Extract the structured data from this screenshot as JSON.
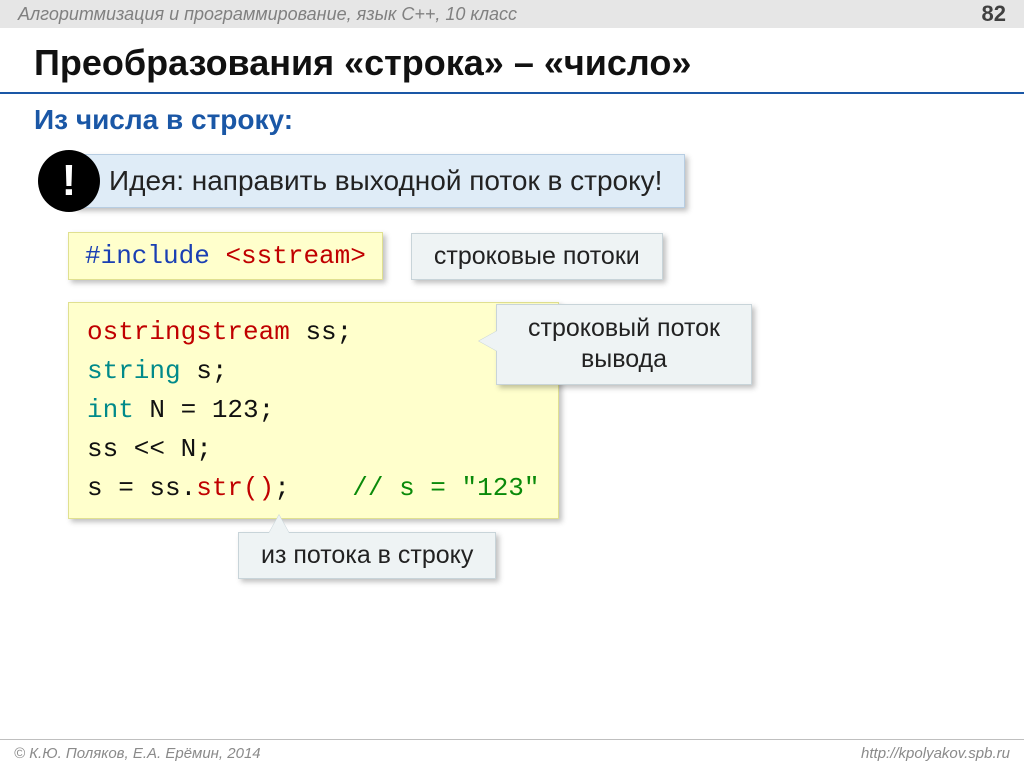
{
  "header": {
    "course": "Алгоритмизация и программирование, язык C++, 10 класс",
    "page": "82"
  },
  "title": "Преобразования «строка» – «число»",
  "subtitle": "Из числа в строку:",
  "idea": {
    "mark": "!",
    "text": "Идея: направить выходной поток в строку!"
  },
  "include": {
    "directive": "#include",
    "header": "<sstream>",
    "label": "строковые потоки"
  },
  "code": {
    "line1_a": "ostringstream",
    "line1_b": " ss;",
    "line2_a": "string",
    "line2_b": " s;",
    "line3_a": "int",
    "line3_b": " N = ",
    "line3_c": "123",
    "line3_d": ";",
    "line4": "ss << N;",
    "line5_a": "s = ss.",
    "line5_b": "str()",
    "line5_c": ";",
    "line5_comment": "// s = \"123\""
  },
  "callouts": {
    "right": "строковый поток вывода",
    "bottom": "из потока в строку"
  },
  "footer": {
    "left": "© К.Ю. Поляков, Е.А. Ерёмин, 2014",
    "right": "http://kpolyakov.spb.ru"
  }
}
